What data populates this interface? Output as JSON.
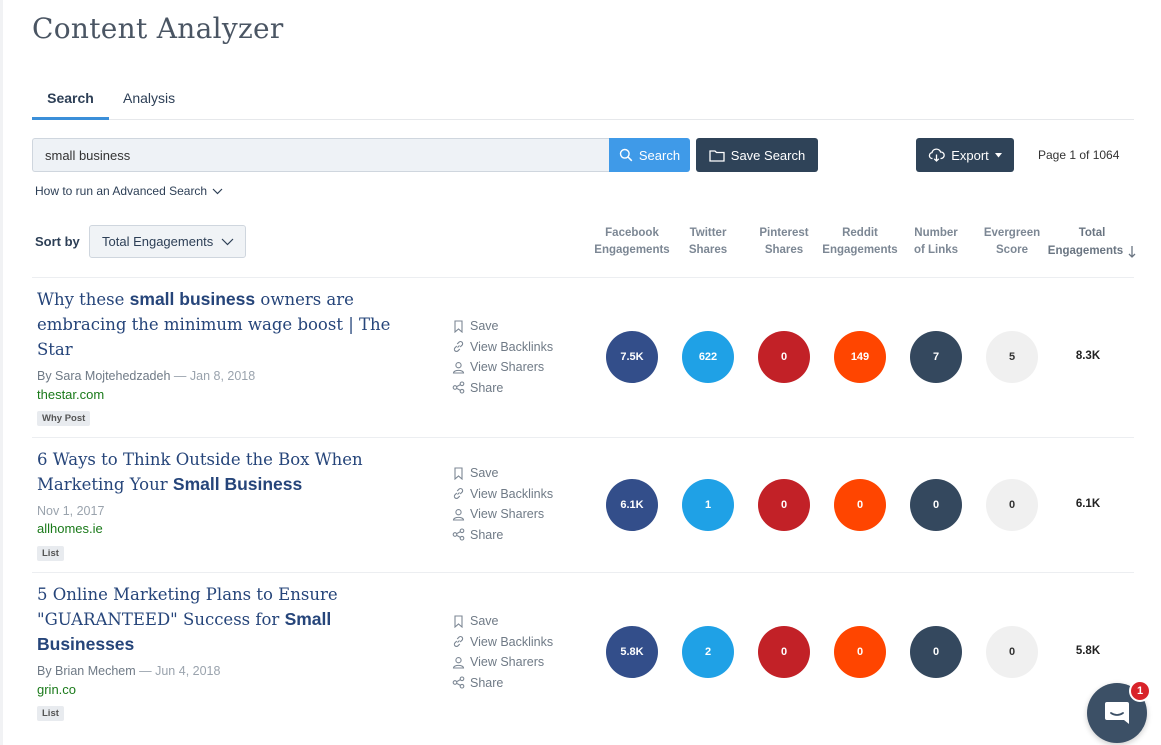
{
  "app": {
    "title": "Content Analyzer"
  },
  "tabs": [
    {
      "label": "Search",
      "active": true
    },
    {
      "label": "Analysis",
      "active": false
    }
  ],
  "search": {
    "value": "small business",
    "button_label": "Search",
    "save_label": "Save Search",
    "export_label": "Export",
    "advanced_link": "How to run an Advanced Search"
  },
  "pagination": {
    "text": "Page 1 of 1064"
  },
  "sort": {
    "label": "Sort by",
    "selected": "Total Engagements"
  },
  "columns": {
    "facebook": {
      "line1": "Facebook",
      "line2": "Engagements"
    },
    "twitter": {
      "line1": "Twitter",
      "line2": "Shares"
    },
    "pinterest": {
      "line1": "Pinterest",
      "line2": "Shares"
    },
    "reddit": {
      "line1": "Reddit",
      "line2": "Engagements"
    },
    "links": {
      "line1": "Number",
      "line2": "of Links"
    },
    "evergreen": {
      "line1": "Evergreen",
      "line2": "Score"
    },
    "total": {
      "line1": "Total",
      "line2": "Engagements"
    }
  },
  "actions": {
    "save": "Save",
    "backlinks": "View Backlinks",
    "sharers": "View Sharers",
    "share": "Share"
  },
  "results": [
    {
      "title_pre": "Why these ",
      "title_bold": "small business",
      "title_post": " owners are embracing the minimum wage boost | The Star",
      "author": "By Sara Mojtehedzadeh",
      "sep": " — ",
      "date": "Jan 8, 2018",
      "domain": "thestar.com",
      "tag": "Why Post",
      "facebook": "7.5K",
      "twitter": "622",
      "pinterest": "0",
      "reddit": "149",
      "links": "7",
      "evergreen": "5",
      "total": "8.3K"
    },
    {
      "title_pre": "6 Ways to Think Outside the Box When Marketing Your ",
      "title_bold": "Small Business",
      "title_post": "",
      "author": "",
      "sep": "",
      "date": "Nov 1, 2017",
      "domain": "allhomes.ie",
      "tag": "List",
      "facebook": "6.1K",
      "twitter": "1",
      "pinterest": "0",
      "reddit": "0",
      "links": "0",
      "evergreen": "0",
      "total": "6.1K"
    },
    {
      "title_pre": "5 Online Marketing Plans to Ensure \"GUARANTEED\" Success for ",
      "title_bold": "Small Businesses",
      "title_post": "",
      "author": "By Brian Mechem",
      "sep": " — ",
      "date": "Jun 4, 2018",
      "domain": "grin.co",
      "tag": "List",
      "facebook": "5.8K",
      "twitter": "2",
      "pinterest": "0",
      "reddit": "0",
      "links": "0",
      "evergreen": "0",
      "total": "5.8K"
    }
  ],
  "chat": {
    "badge": "1"
  },
  "colors": {
    "facebook": "#334e8a",
    "twitter": "#1fa1e6",
    "pinterest": "#c22127",
    "reddit": "#ff4500",
    "links": "#34485e",
    "evergreen": "#f0f0f0",
    "accent": "#3f9ae8",
    "title_link": "#26457a",
    "domain": "#1a7a1a"
  }
}
